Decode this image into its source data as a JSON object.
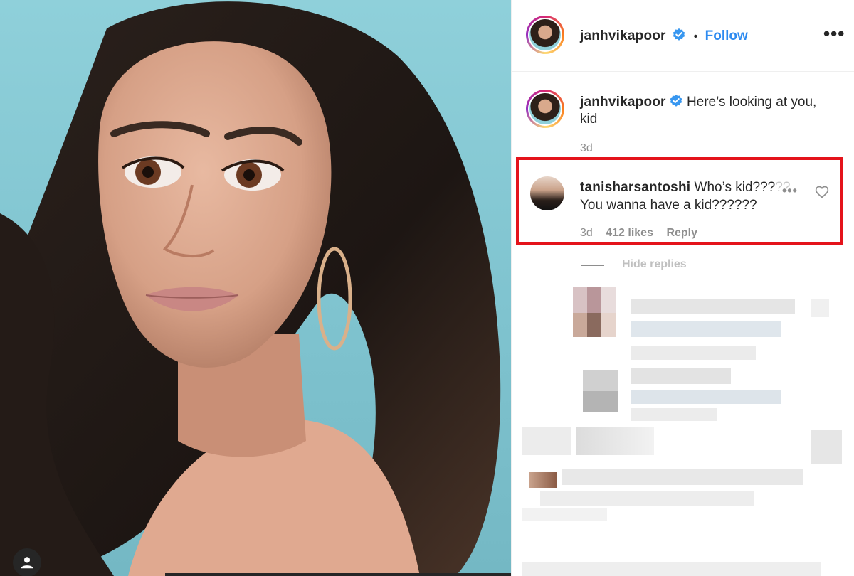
{
  "post": {
    "author": "janhvikapoor",
    "follow_label": "Follow",
    "separator": "•",
    "more_label": "•••",
    "caption": "Here’s looking at you, kid",
    "caption_time": "3d"
  },
  "highlighted_comment": {
    "author": "tanisharsantoshi",
    "text_main": "Who’s kid???",
    "text_faded": "??",
    "text_line2": "You wanna have a kid??????",
    "time": "3d",
    "likes": "412 likes",
    "reply_label": "Reply",
    "more_label": "•••"
  },
  "replies": {
    "toggle_label": "Hide replies"
  },
  "colors": {
    "accent": "#2e8bf0",
    "highlight": "#e4131b",
    "photo_bg": "#8fd0da",
    "meta_text": "#8e8e8e"
  },
  "icons": {
    "verified": "verified-badge-icon",
    "heart": "heart-outline-icon",
    "user_tag": "user-tag-icon",
    "more": "more-options-icon"
  }
}
